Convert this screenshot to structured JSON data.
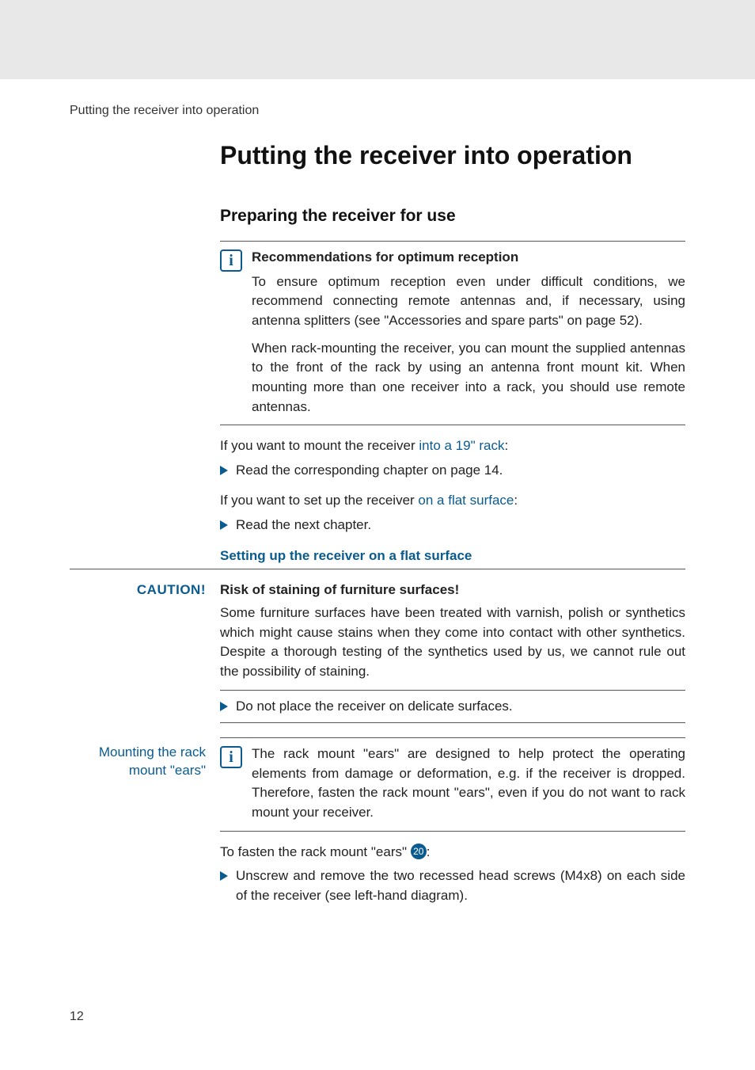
{
  "header_small": "Putting the receiver into operation",
  "h1": "Putting the receiver into operation",
  "h2": "Preparing the receiver for use",
  "info1": {
    "title": "Recommendations for optimum reception",
    "p1": "To ensure optimum reception even under difficult conditions, we recommend connecting remote antennas and, if necessary, using antenna splitters (see \"Accessories and spare parts\" on page 52).",
    "p2": "When rack-mounting the receiver, you can mount the supplied antennas to the front of the rack by using an antenna front mount kit. When mounting more than one receiver into a rack, you should use remote antennas."
  },
  "line1_pre": "If you want to mount the receiver ",
  "line1_link": "into a 19\" rack",
  "line1_post": ":",
  "bullet1": "Read the corresponding chapter on page 14.",
  "line2_pre": "If you want to set up the receiver ",
  "line2_link": "on a flat surface",
  "line2_post": ":",
  "bullet2": "Read the next chapter.",
  "sub_heading": "Setting up the receiver on a flat surface",
  "caution": {
    "label": "CAUTION!",
    "title": "Risk of staining of furniture surfaces!",
    "body": "Some furniture surfaces have been treated with varnish, polish or synthetics which might cause stains when they come into contact with other synthetics. Despite a thorough testing of the synthetics used by us, we cannot rule out the possibility of staining.",
    "footer": "Do not place the receiver on delicate surfaces."
  },
  "side": {
    "label_l1": "Mounting the rack",
    "label_l2": "mount \"ears\"",
    "body": "The rack mount \"ears\" are designed to help protect the operating elements from damage or deformation, e.g. if the receiver is dropped. Therefore, fasten the rack mount \"ears\", even if you do not want to rack mount your receiver."
  },
  "after1_pre": "To fasten the rack mount \"ears\" ",
  "after1_num": "20",
  "after1_post": ":",
  "bullet3": "Unscrew and remove the two recessed head screws (M4x8) on each side of the receiver (see left-hand diagram).",
  "page_number": "12"
}
